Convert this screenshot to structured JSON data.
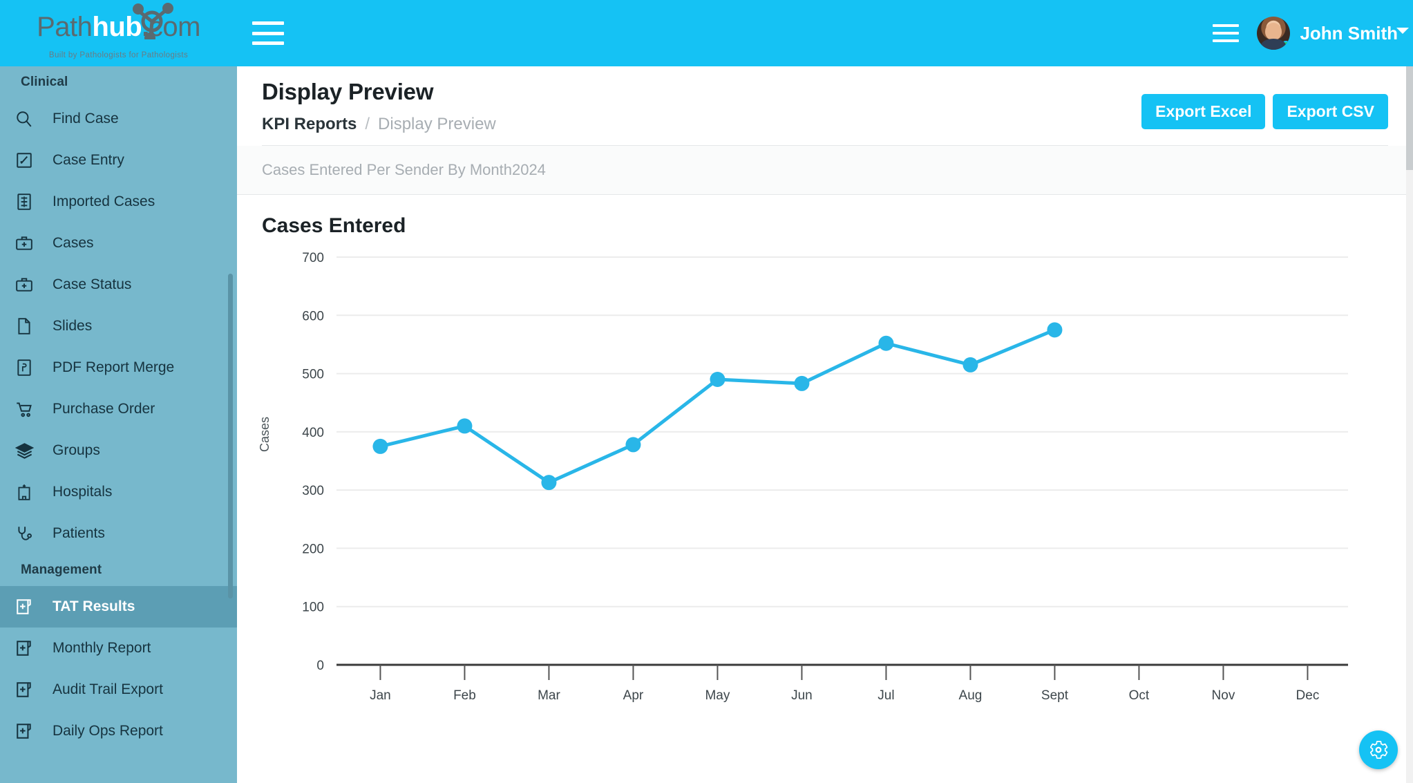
{
  "brand": {
    "logo_path": "Path",
    "logo_hub": "hub",
    "logo_dot": ".",
    "logo_com": "com",
    "tagline": "Built by Pathologists for Pathologists",
    "accent_color": "#15C2F4",
    "sidebar_color": "#77B8CC",
    "sidebar_active_color": "#5C9EB4"
  },
  "topbar": {
    "menu_icon": "hamburger-icon",
    "right_menu_icon": "hamburger-icon",
    "user_name": "John Smith",
    "status": "online",
    "caret_icon": "chevron-down-icon"
  },
  "sidebar": {
    "groups": [
      {
        "label": "Clinical",
        "items": [
          {
            "label": "Find Case",
            "icon": "search-icon",
            "active": false
          },
          {
            "label": "Case Entry",
            "icon": "pencil-square-icon",
            "active": false
          },
          {
            "label": "Imported Cases",
            "icon": "import-document-icon",
            "active": false
          },
          {
            "label": "Cases",
            "icon": "medical-case-icon",
            "active": false
          },
          {
            "label": "Case Status",
            "icon": "medical-case-icon",
            "active": false
          },
          {
            "label": "Slides",
            "icon": "document-icon",
            "active": false
          },
          {
            "label": "PDF Report Merge",
            "icon": "pdf-file-icon",
            "active": false
          },
          {
            "label": "Purchase Order",
            "icon": "shopping-cart-icon",
            "active": false
          },
          {
            "label": "Groups",
            "icon": "layers-icon",
            "active": false
          },
          {
            "label": "Hospitals",
            "icon": "hospital-icon",
            "active": false
          },
          {
            "label": "Patients",
            "icon": "stethoscope-icon",
            "active": false
          }
        ]
      },
      {
        "label": "Management",
        "items": [
          {
            "label": "TAT Results",
            "icon": "report-add-icon",
            "active": true
          },
          {
            "label": "Monthly Report",
            "icon": "report-add-icon",
            "active": false
          },
          {
            "label": "Audit Trail Export",
            "icon": "report-add-icon",
            "active": false
          },
          {
            "label": "Daily Ops Report",
            "icon": "report-add-icon",
            "active": false
          }
        ]
      }
    ]
  },
  "page": {
    "title": "Display Preview",
    "breadcrumb_parent": "KPI Reports",
    "breadcrumb_sep": "/",
    "breadcrumb_current": "Display Preview",
    "report_subtitle": "Cases Entered Per Sender By Month2024",
    "export_excel_label": "Export Excel",
    "export_csv_label": "Export CSV",
    "settings_icon": "gear-icon"
  },
  "chart_data": {
    "type": "line",
    "title": "Cases Entered",
    "xlabel": "",
    "ylabel": "Cases",
    "categories": [
      "Jan",
      "Feb",
      "Mar",
      "Apr",
      "May",
      "Jun",
      "Jul",
      "Aug",
      "Sept",
      "Oct",
      "Nov",
      "Dec"
    ],
    "series": [
      {
        "name": "Cases Entered",
        "color": "#29B6E8",
        "values": [
          375,
          410,
          313,
          378,
          490,
          483,
          552,
          515,
          575,
          null,
          null,
          null
        ]
      }
    ],
    "ylim": [
      0,
      700
    ],
    "yticks": [
      0,
      100,
      200,
      300,
      400,
      500,
      600,
      700
    ],
    "grid": true,
    "legend": "none",
    "marker": "circle"
  }
}
